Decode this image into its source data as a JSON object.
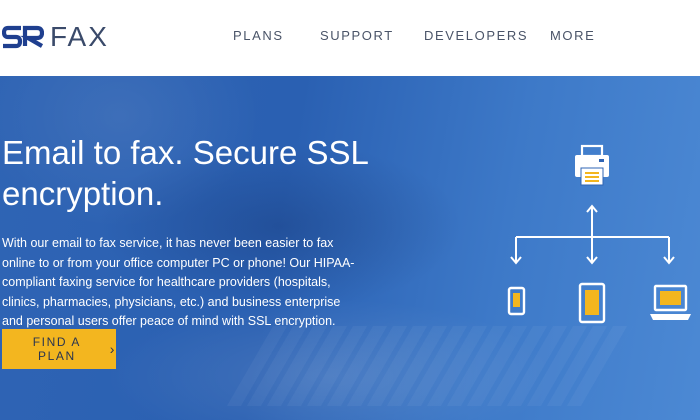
{
  "header": {
    "logo_text": "FAX",
    "nav": [
      {
        "label": "PLANS"
      },
      {
        "label": "SUPPORT"
      },
      {
        "label": "DEVELOPERS"
      },
      {
        "label": "MORE"
      }
    ]
  },
  "hero": {
    "title_lines": [
      "Email to fax. Secure SSL",
      "encryption."
    ],
    "body_lines": [
      "With our email to fax service, it has never been easier to fax",
      "online to or from your office computer PC or phone! Our HIPAA-",
      "compliant faxing service for healthcare providers (hospitals,",
      "clinics, pharmacies, physicians, etc.) and business enterprise",
      "and personal users offer peace of mind with SSL encryption."
    ],
    "cta_label": "FIND A PLAN",
    "cta_icon": "chevron-right-icon",
    "diagram_icons": [
      "fax-machine-icon",
      "smartphone-icon",
      "tablet-icon",
      "laptop-icon"
    ]
  },
  "colors": {
    "hero_blue": "#2f64b4",
    "cta_yellow": "#f3b61f",
    "logo_navy": "#1f3f8f",
    "nav_text": "#4a5468"
  }
}
